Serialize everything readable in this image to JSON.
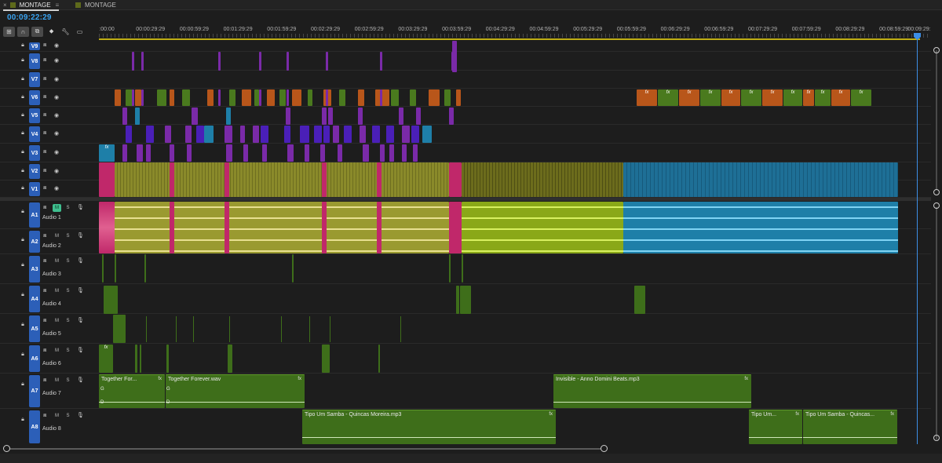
{
  "tabs": [
    {
      "label": "MONTAGE",
      "active": true
    },
    {
      "label": "MONTAGE",
      "active": false
    }
  ],
  "timecode": "00:09:22:29",
  "ruler": {
    "labels": [
      ":00:00",
      "00:00:29:29",
      "00:00:59:29",
      "00:01:29:29",
      "00:01:59:29",
      "00:02:29:29",
      "00:02:59:29",
      "00:03:29:29",
      "00:03:59:29",
      "00:04:29:29",
      "00:04:59:29",
      "00:05:29:29",
      "00:05:59:29",
      "00:06:29:29",
      "00:06:59:29",
      "00:07:29:29",
      "00:07:59:29",
      "00:08:29:29",
      "00:08:59:29",
      "00:09:29:"
    ]
  },
  "video_tracks": [
    "V9",
    "V8",
    "V7",
    "V6",
    "V5",
    "V4",
    "V3",
    "V2",
    "V1"
  ],
  "audio_tracks": [
    {
      "id": "A1",
      "name": "Audio 1",
      "mute_on": true
    },
    {
      "id": "A2",
      "name": "Audio 2",
      "mute_on": false
    },
    {
      "id": "A3",
      "name": "Audio 3",
      "mute_on": false
    },
    {
      "id": "A4",
      "name": "Audio 4",
      "mute_on": false
    },
    {
      "id": "A5",
      "name": "Audio 5",
      "mute_on": false
    },
    {
      "id": "A6",
      "name": "Audio 6",
      "mute_on": false
    },
    {
      "id": "A7",
      "name": "Audio 7",
      "mute_on": false
    },
    {
      "id": "A8",
      "name": "Audio 8",
      "mute_on": false
    }
  ],
  "labels": {
    "mute": "M",
    "solo": "S",
    "fx": "fx"
  },
  "audio_clips": {
    "a7": [
      "Together For...",
      "Together Forever.wav",
      "Invisible - Anno Domini Beats.mp3"
    ],
    "a8": [
      "Tipo Um Samba - Quincas Moreira.mp3",
      "Tipo Um...",
      "Tipo Um Samba - Quincas..."
    ],
    "markers": [
      "G",
      "D",
      "G",
      "D"
    ]
  },
  "colors": {
    "accent": "#3aa3f0",
    "track_label": "#2c5fb8",
    "orange": "#b8561a",
    "green": "#4a7a1e",
    "purple": "#7a2aa8",
    "violet": "#4a1fb8",
    "olive": "#8a8a2a",
    "magenta": "#c0286a",
    "teal": "#1e7fa8",
    "lime": "#a8c81e",
    "audio_green": "#3e6e1a"
  },
  "icons": [
    "wrench-icon",
    "snap-icon",
    "linked-selection-icon",
    "marker-icon",
    "captions-icon",
    "lock-icon",
    "camera-icon",
    "eye-icon",
    "mic-icon"
  ]
}
